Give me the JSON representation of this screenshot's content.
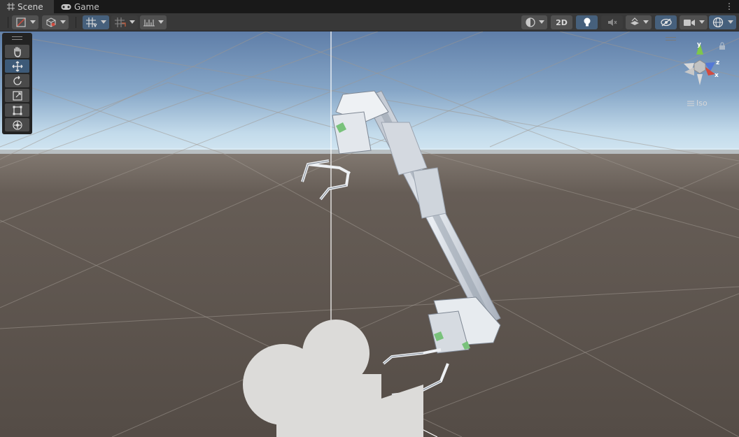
{
  "tabs": [
    {
      "label": "Scene",
      "icon": "grid-icon",
      "active": true
    },
    {
      "label": "Game",
      "icon": "gamepad-icon",
      "active": false
    }
  ],
  "toolbar": {
    "mode_2d_label": "2D",
    "icons": [
      "draw-mode-icon",
      "shading-cube-icon",
      "grid-snap-icon",
      "increment-snap-icon",
      "ruler-icon",
      "render-mode-icon",
      "lighting-bulb-icon",
      "audio-mute-icon",
      "effects-icon",
      "hidden-objects-icon",
      "camera-icon",
      "gizmos-icon"
    ]
  },
  "tools": [
    "hand-tool-icon",
    "move-tool-icon",
    "rotate-tool-icon",
    "scale-tool-icon",
    "rect-tool-icon",
    "transform-tool-icon"
  ],
  "gizmo": {
    "x_label": "x",
    "y_label": "y",
    "z_label": "z",
    "projection_label": "Iso"
  },
  "colors": {
    "accent": "#46607c",
    "panel": "#383838",
    "sky_top": "#5f7ea8",
    "horizon": "#d4e6f3",
    "ground": "#5b534c"
  }
}
